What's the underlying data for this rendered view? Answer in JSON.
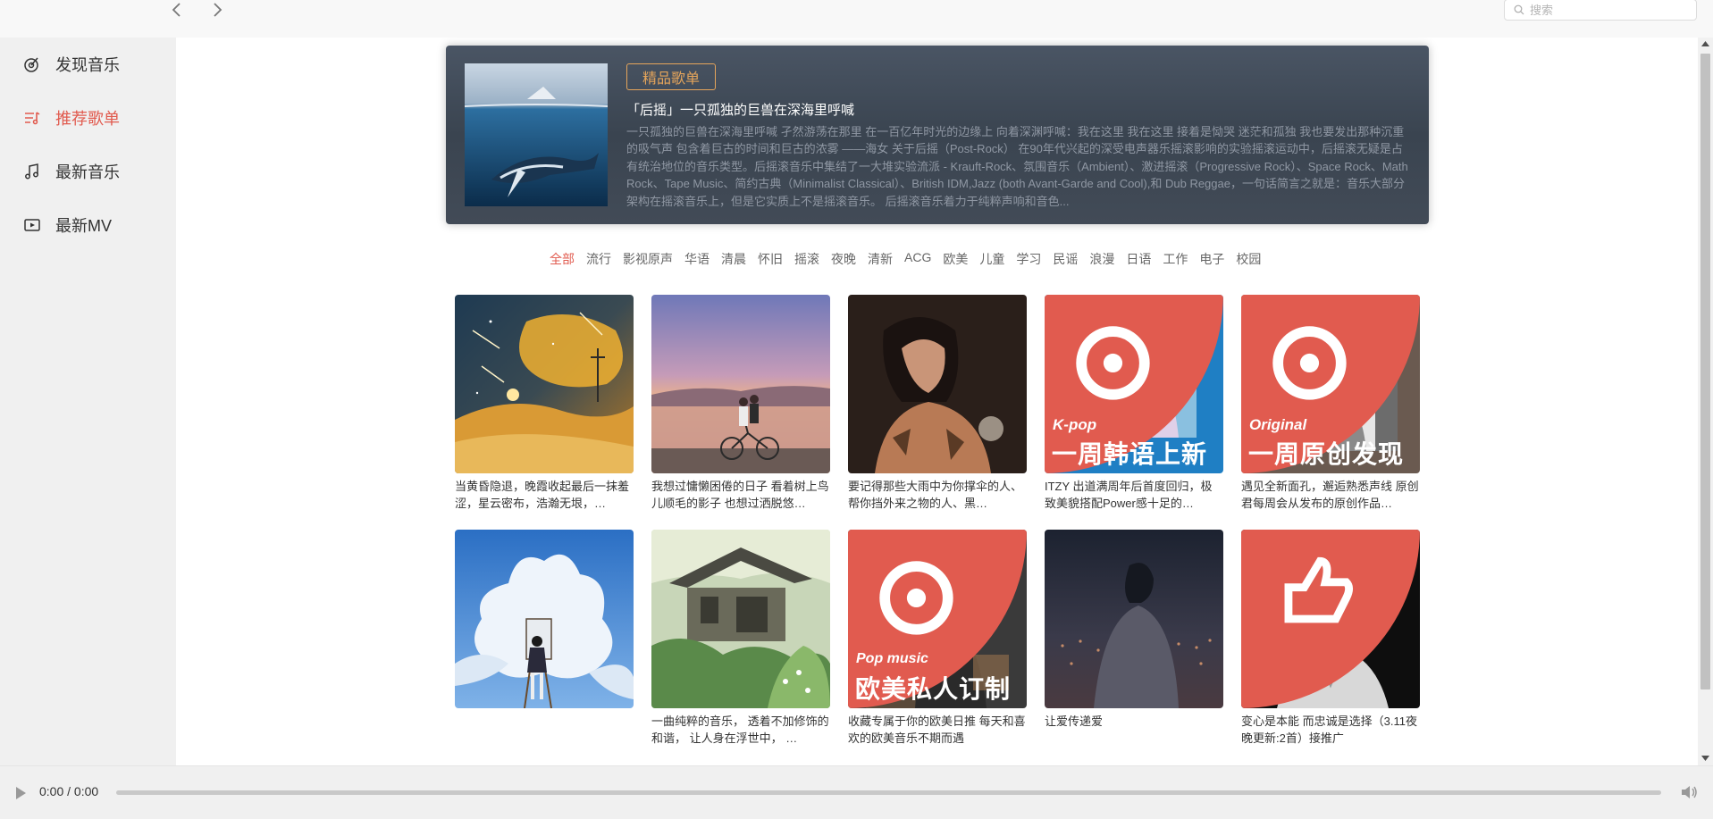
{
  "header": {
    "back_icon": "chevron-left-icon",
    "forward_icon": "chevron-right-icon",
    "search_placeholder": "搜索"
  },
  "sidebar": {
    "items": [
      {
        "label": "发现音乐",
        "icon": "disc-icon",
        "active": false
      },
      {
        "label": "推荐歌单",
        "icon": "playlist-icon",
        "active": true
      },
      {
        "label": "最新音乐",
        "icon": "music-note-icon",
        "active": false
      },
      {
        "label": "最新MV",
        "icon": "video-icon",
        "active": false
      }
    ]
  },
  "banner": {
    "tag": "精品歌单",
    "title": "「后摇」一只孤独的巨兽在深海里呼喊",
    "description": "一只孤独的巨兽在深海里呼喊 孑然游荡在那里 在一百亿年时光的边缘上 向着深渊呼喊：我在这里 我在这里 接着是恸哭 迷茫和孤独 我也要发出那种沉重的吸气声 包含着巨古的时间和巨古的浓雾 ——海女  关于后摇（Post-Rock） 在90年代兴起的深受电声器乐摇滚影响的实验摇滚运动中，后摇滚无疑是占有统治地位的音乐类型。后摇滚音乐中集结了一大堆实验流派 - Krauft-Rock、氛围音乐（Ambient）、激进摇滚（Progressive Rock）、Space Rock、Math Rock、Tape Music、简约古典（Minimalist Classical）、British IDM,Jazz (both Avant-Garde and Cool),和 Dub Reggae，一句话简言之就是：音乐大部分架构在摇滚音乐上，但是它实质上不是摇滚音乐。 后摇滚音乐着力于纯粹声响和音色..."
  },
  "categories": [
    "全部",
    "流行",
    "影视原声",
    "华语",
    "清晨",
    "怀旧",
    "摇滚",
    "夜晚",
    "清新",
    "ACG",
    "欧美",
    "儿童",
    "学习",
    "民谣",
    "浪漫",
    "日语",
    "工作",
    "电子",
    "校园"
  ],
  "active_category": "全部",
  "playlists": [
    {
      "title": "当黄昏隐退，晚霞收起最后一抹羞涩，星云密布，浩瀚无垠，…",
      "art": "starry-desert-art"
    },
    {
      "title": "我想过慵懒困倦的日子 看着树上鸟儿顺毛的影子 也想过洒脱悠…",
      "art": "sunset-bicycle-art"
    },
    {
      "title": "要记得那些大雨中为你撑伞的人、帮你挡外来之物的人、黑…",
      "art": "woman-portrait-art"
    },
    {
      "title": "ITZY 出道满周年后首度回归，极致美貌搭配Power感十足的…",
      "art": "kpop-group-art",
      "overlay_en": "K-pop",
      "overlay_cn": "一周韩语上新"
    },
    {
      "title": "遇见全新面孔，邂逅熟悉声线 原创君每周会从发布的原创作品…",
      "art": "original-portrait-art",
      "overlay_en": "Original",
      "overlay_cn": "一周原创发现"
    },
    {
      "title": "",
      "art": "sky-painting-art"
    },
    {
      "title": "一曲纯粹的音乐， 透着不加修饰的和谐， 让人身在浮世中， …",
      "art": "forest-house-art"
    },
    {
      "title": "收藏专属于你的欧美日推 每天和喜欢的欧美音乐不期而遇",
      "art": "pop-singer-art",
      "overlay_en": "Pop music",
      "overlay_cn": "欧美私人订制"
    },
    {
      "title": "让爱传递爱",
      "art": "night-city-art"
    },
    {
      "title": "变心是本能 而忠诚是选择（3.11夜晚更新:2首）接推广",
      "art": "anime-boy-art"
    }
  ],
  "player": {
    "time": "0:00 / 0:00",
    "progress": 0,
    "play_icon": "play-icon",
    "volume_icon": "volume-icon"
  },
  "colors": {
    "accent": "#e15b4f",
    "tag": "#e5a55b",
    "badge": "#e15b4f"
  }
}
